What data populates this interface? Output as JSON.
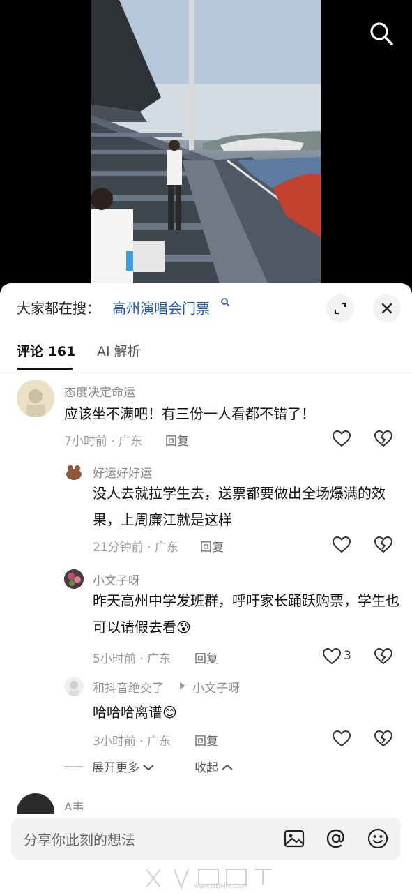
{
  "search_suggestion": {
    "prefix": "大家都在搜：",
    "query": "高州演唱会门票"
  },
  "tabs": [
    {
      "label": "评论 161"
    },
    {
      "label": "AI 解析"
    }
  ],
  "comments": [
    {
      "user": "态度决定命运",
      "text": "应该坐不满吧！有三份一人看都不错了！",
      "time_location": "7小时前 · 广东",
      "reply_label": "回复"
    },
    {
      "user": "好运好好运",
      "text": "没人去就拉学生去，送票都要做出全场爆满的效果，上周廉江就是这样",
      "time_location": "21分钟前 · 广东",
      "reply_label": "回复"
    },
    {
      "user": "小文子呀",
      "text": "昨天高州中学发班群，呼吁家长踊跃购票，学生也可以请假去看",
      "emoji": "😰",
      "time_location": "5小时前 · 广东",
      "reply_label": "回复",
      "likes": "3"
    },
    {
      "user": "和抖音绝交了",
      "reply_to": "小文子呀",
      "text": "哈哈哈离谱",
      "emoji": "😊",
      "time_location": "3小时前 · 广东",
      "reply_label": "回复"
    }
  ],
  "expand_more_label": "展开更多",
  "collapse_label": "收起",
  "next_comment_user": "A韦",
  "input": {
    "placeholder": "分享你此刻的想法"
  },
  "watermark": "www.GDMM.COM",
  "colors": {
    "link": "#1f57b8",
    "muted": "#9a9a9a",
    "sheet": "#ffffff",
    "input_bg": "#f2f2f2"
  },
  "icons": [
    "search-icon",
    "expand-icon",
    "close-icon",
    "heart-icon",
    "broken-heart-icon",
    "image-icon",
    "at-icon",
    "emoji-icon"
  ]
}
